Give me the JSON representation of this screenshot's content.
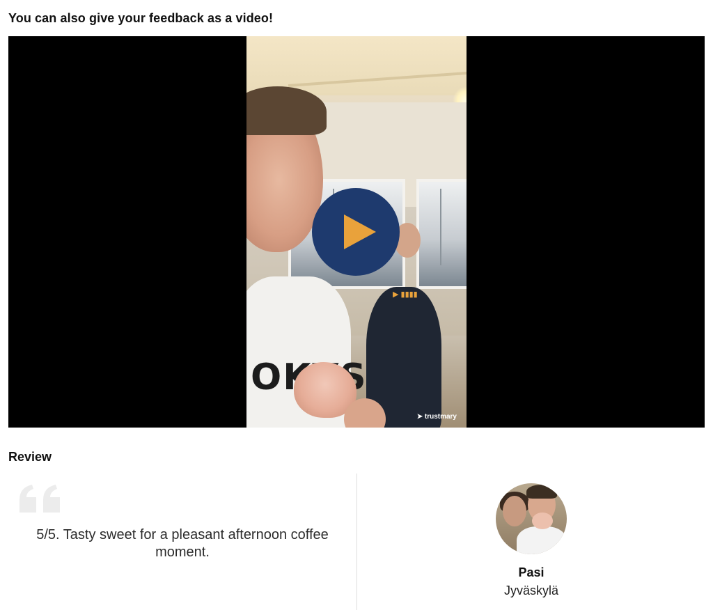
{
  "header": {
    "video_feedback_prompt": "You can also give your feedback as a video!"
  },
  "video": {
    "watermark": "trustmary",
    "shirt_text": "OKYS"
  },
  "review": {
    "section_title": "Review",
    "text": "5/5. Tasty sweet for a pleasant afternoon coffee moment.",
    "reviewer": {
      "name": "Pasi",
      "location": "Jyväskylä"
    }
  },
  "colors": {
    "play_button_bg": "#1e3a6e",
    "play_triangle": "#e9a23b",
    "quote_icon": "#ececec"
  },
  "icons": {
    "play": "play-icon",
    "quote": "quote-icon"
  }
}
